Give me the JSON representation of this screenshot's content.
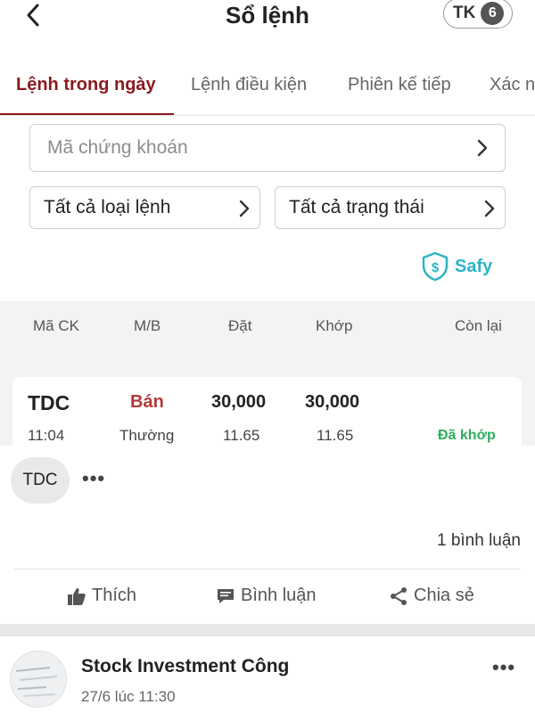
{
  "header": {
    "back_icon": "chevron-left-icon",
    "title": "Sổ lệnh",
    "account_label": "TK",
    "account_count": "6"
  },
  "tabs": [
    {
      "label": "Lệnh trong ngày",
      "active": true
    },
    {
      "label": "Lệnh điều kiện",
      "active": false
    },
    {
      "label": "Phiên kế tiếp",
      "active": false
    },
    {
      "label": "Xác n",
      "active": false
    }
  ],
  "filters": {
    "search_placeholder": "Mã chứng khoán",
    "order_type": "Tất cả loại lệnh",
    "order_status": "Tất cả trạng thái"
  },
  "safy": {
    "label": "Safy",
    "icon": "shield-dollar-icon"
  },
  "orders": {
    "columns": [
      "Mã CK",
      "M/B",
      "Đặt",
      "Khớp",
      "Còn lại"
    ],
    "rows": [
      {
        "symbol": "TDC",
        "side": "Bán",
        "placed_qty": "30,000",
        "matched_qty": "30,000",
        "time": "11:04",
        "order_type": "Thường",
        "placed_price": "11.65",
        "matched_price": "11.65",
        "status": "Đã khớp"
      }
    ]
  },
  "post": {
    "tag": "TDC",
    "comment_count": "1 bình luận",
    "actions": {
      "like": "Thích",
      "comment": "Bình luận",
      "share": "Chia sẻ"
    },
    "next_author": "Stock Investment Công",
    "next_time": "27/6 lúc 11:30"
  },
  "colors": {
    "accent": "#8a1a1f",
    "sell": "#b23a3a",
    "matched": "#2eae5e",
    "safy": "#2bb3c6"
  }
}
